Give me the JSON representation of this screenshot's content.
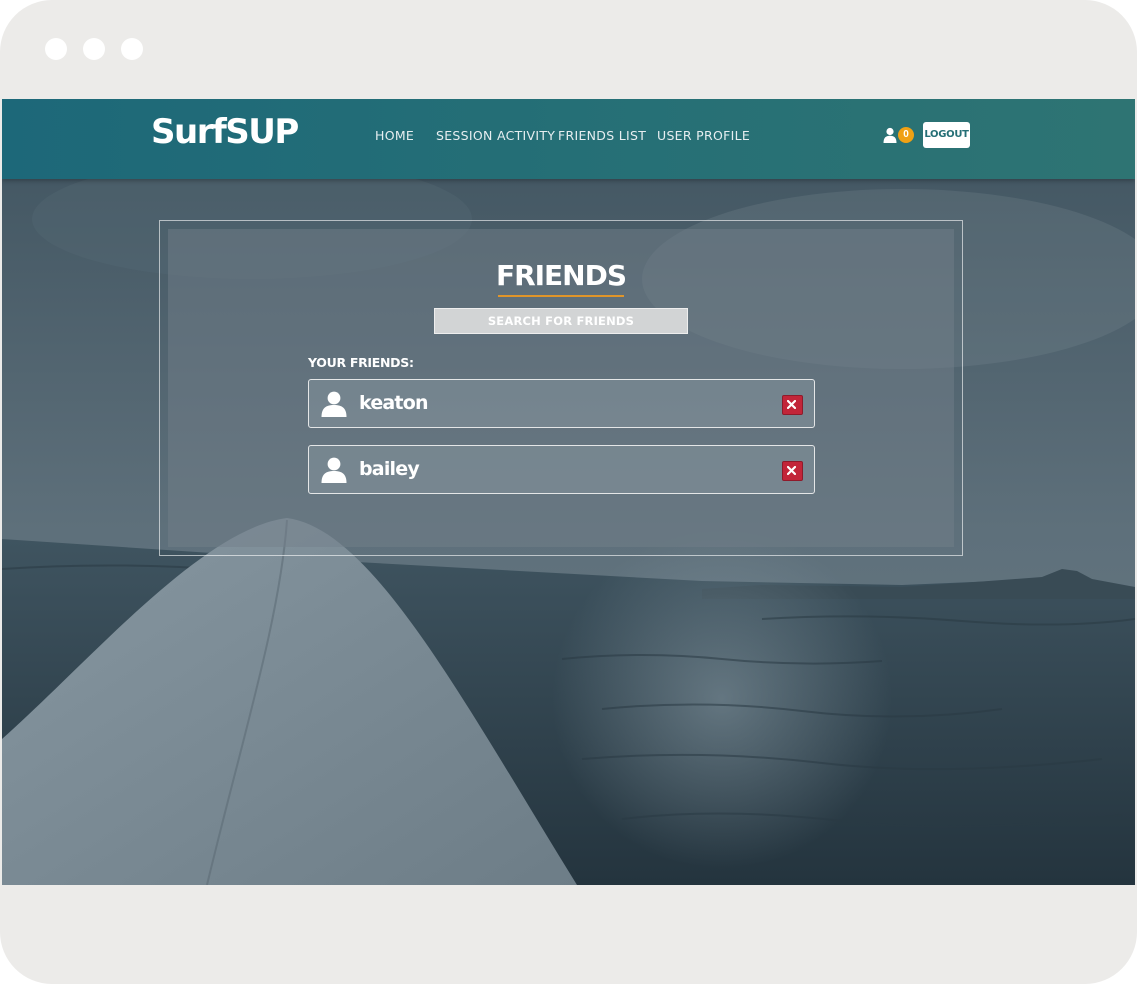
{
  "nav": {
    "brand": "SurfSUP",
    "links": [
      "HOME",
      "SESSION ACTIVITY",
      "FRIENDS LIST",
      "USER PROFILE"
    ],
    "notification_count": "0",
    "logout_label": "LOGOUT"
  },
  "friends": {
    "title": "FRIENDS",
    "search_label": "SEARCH FOR FRIENDS",
    "list_label": "YOUR FRIENDS:",
    "list": [
      {
        "name": "keaton"
      },
      {
        "name": "bailey"
      }
    ]
  },
  "colors": {
    "navbar_start": "#1d6879",
    "navbar_end": "#2e7473",
    "accent_rule": "#e0952a",
    "badge": "#f0a114",
    "remove": "#c22539"
  },
  "icons": {
    "user": "user-icon",
    "remove": "close-icon"
  }
}
